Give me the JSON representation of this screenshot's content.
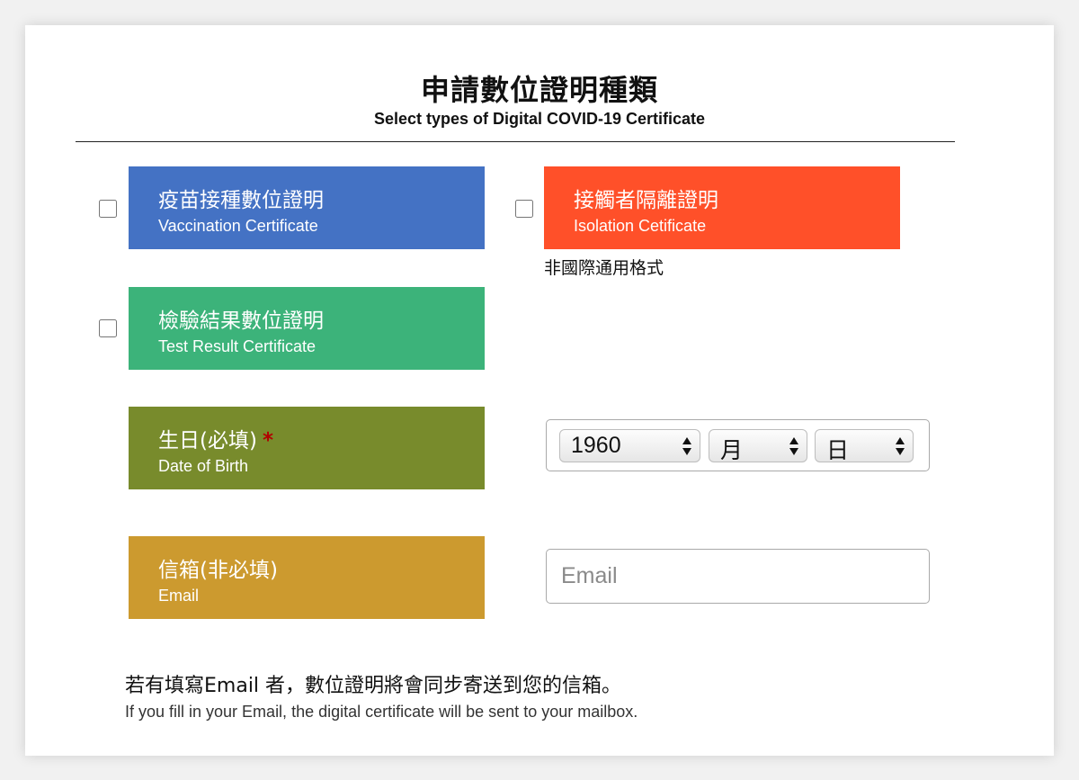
{
  "header": {
    "title": "申請數位證明種類",
    "subtitle": "Select types of Digital COVID-19 Certificate"
  },
  "certificates": [
    {
      "zh": "疫苗接種數位證明",
      "en": "Vaccination Certificate",
      "color": "#4472c4",
      "checked": false
    },
    {
      "zh": "接觸者隔離證明",
      "en": "Isolation Cetificate",
      "color": "#ff5029",
      "checked": false,
      "note": "非國際通用格式"
    },
    {
      "zh": "檢驗結果數位證明",
      "en": "Test Result Certificate",
      "color": "#3cb37a",
      "checked": false
    }
  ],
  "birth": {
    "zh": "生日(必填)",
    "required_mark": "*",
    "en": "Date of Birth",
    "color": "#788b2c",
    "year": "1960",
    "month": "月",
    "day": "日"
  },
  "email": {
    "zh": "信箱(非必填)",
    "en": "Email",
    "color": "#cc9a2f",
    "placeholder": "Email",
    "value": ""
  },
  "footer": {
    "zh": "若有填寫Email 者，數位證明將會同步寄送到您的信箱。",
    "en": "If you fill in your Email, the digital certificate will be sent to your mailbox."
  }
}
